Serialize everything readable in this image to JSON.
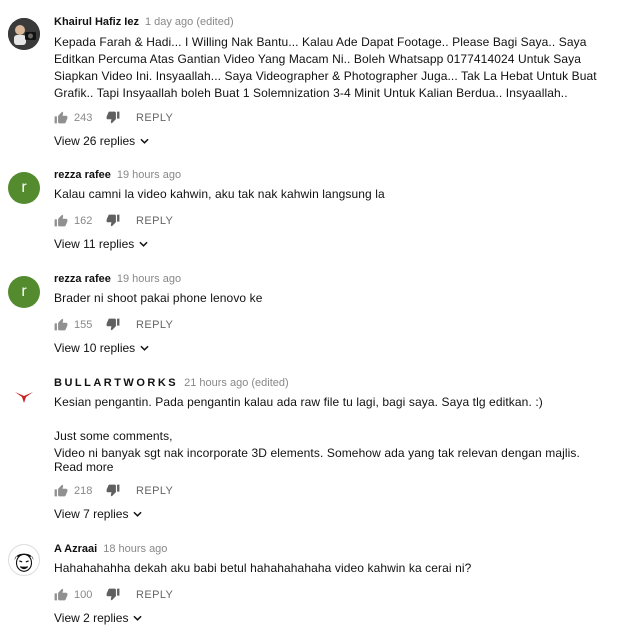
{
  "comments": [
    {
      "author": "Khairul Hafiz Iez",
      "time": "1 day ago (edited)",
      "avatar": {
        "type": "photo"
      },
      "paragraphs": [
        "Kepada Farah & Hadi... I Willing Nak Bantu... Kalau Ade Dapat Footage.. Please Bagi Saya.. Saya Editkan Percuma Atas Gantian Video Yang Macam Ni.. Boleh Whatsapp 0177414024 Untuk Saya Siapkan Video Ini. Insyaallah... Saya Videographer & Photographer Juga... Tak La Hebat Untuk Buat Grafik.. Tapi Insyaallah boleh Buat 1 Solemnization 3-4 Minit Untuk Kalian Berdua.. Insyaallah.."
      ],
      "likes": "243",
      "reply_label": "REPLY",
      "view_replies": "View 26 replies"
    },
    {
      "author": "rezza rafee",
      "time": "19 hours ago",
      "avatar": {
        "type": "letter",
        "letter": "r",
        "color": "#558b2f"
      },
      "paragraphs": [
        "Kalau camni la video kahwin, aku tak nak kahwin langsung la"
      ],
      "likes": "162",
      "reply_label": "REPLY",
      "view_replies": "View 11 replies"
    },
    {
      "author": "rezza rafee",
      "time": "19 hours ago",
      "avatar": {
        "type": "letter",
        "letter": "r",
        "color": "#558b2f"
      },
      "paragraphs": [
        "Brader ni shoot pakai phone lenovo ke"
      ],
      "likes": "155",
      "reply_label": "REPLY",
      "view_replies": "View 10 replies"
    },
    {
      "author": "BULLARTWORKS",
      "time": "21 hours ago (edited)",
      "avatar": {
        "type": "logo",
        "color": "#cc1f1f"
      },
      "paragraphs": [
        "Kesian pengantin. Pada pengantin kalau ada raw file tu lagi, bagi saya. Saya tlg editkan. :)",
        "",
        "Just some comments,",
        "Video ni banyak sgt nak incorporate 3D elements. Somehow ada yang tak relevan dengan majlis."
      ],
      "read_more": "Read more",
      "likes": "218",
      "reply_label": "REPLY",
      "view_replies": "View 7 replies"
    },
    {
      "author": "A Azraai",
      "time": "18 hours ago",
      "avatar": {
        "type": "face"
      },
      "paragraphs": [
        "Hahahahahha dekah aku babi betul hahahahahaha video kahwin ka cerai ni?"
      ],
      "likes": "100",
      "reply_label": "REPLY",
      "view_replies": "View 2 replies"
    }
  ]
}
